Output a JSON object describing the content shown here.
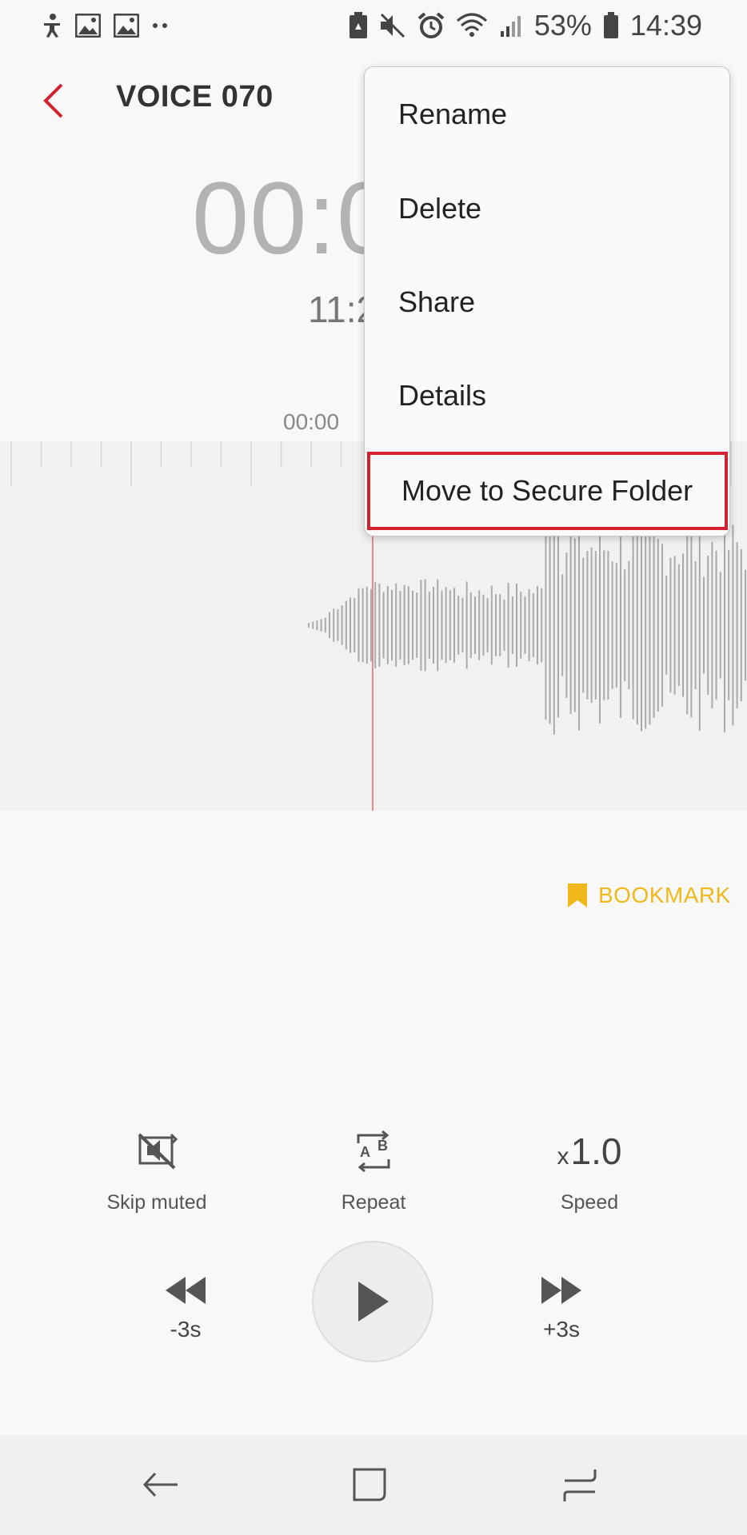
{
  "status_bar": {
    "battery_percent": "53%",
    "time": "14:39"
  },
  "header": {
    "title": "VOICE 070"
  },
  "playback": {
    "elapsed_time": "00:0",
    "total_time": "11:2",
    "cursor_time": "00:00"
  },
  "bookmark": {
    "label": "BOOKMARK",
    "color": "#f1b81b"
  },
  "controls": {
    "skip_muted_label": "Skip muted",
    "repeat_label": "Repeat",
    "repeat_a": "A",
    "repeat_b": "B",
    "speed_prefix": "x",
    "speed_value": "1.0",
    "speed_label": "Speed"
  },
  "transport": {
    "rewind_label": "-3s",
    "forward_label": "+3s"
  },
  "menu": {
    "items": [
      {
        "label": "Rename"
      },
      {
        "label": "Delete"
      },
      {
        "label": "Share"
      },
      {
        "label": "Details"
      },
      {
        "label": "Move to Secure Folder",
        "highlighted": true
      }
    ],
    "highlight_color": "#d3212f"
  },
  "colors": {
    "accent_red": "#d3212f",
    "waveform_gray": "#aaaaaa",
    "playhead": "#e58b88"
  }
}
